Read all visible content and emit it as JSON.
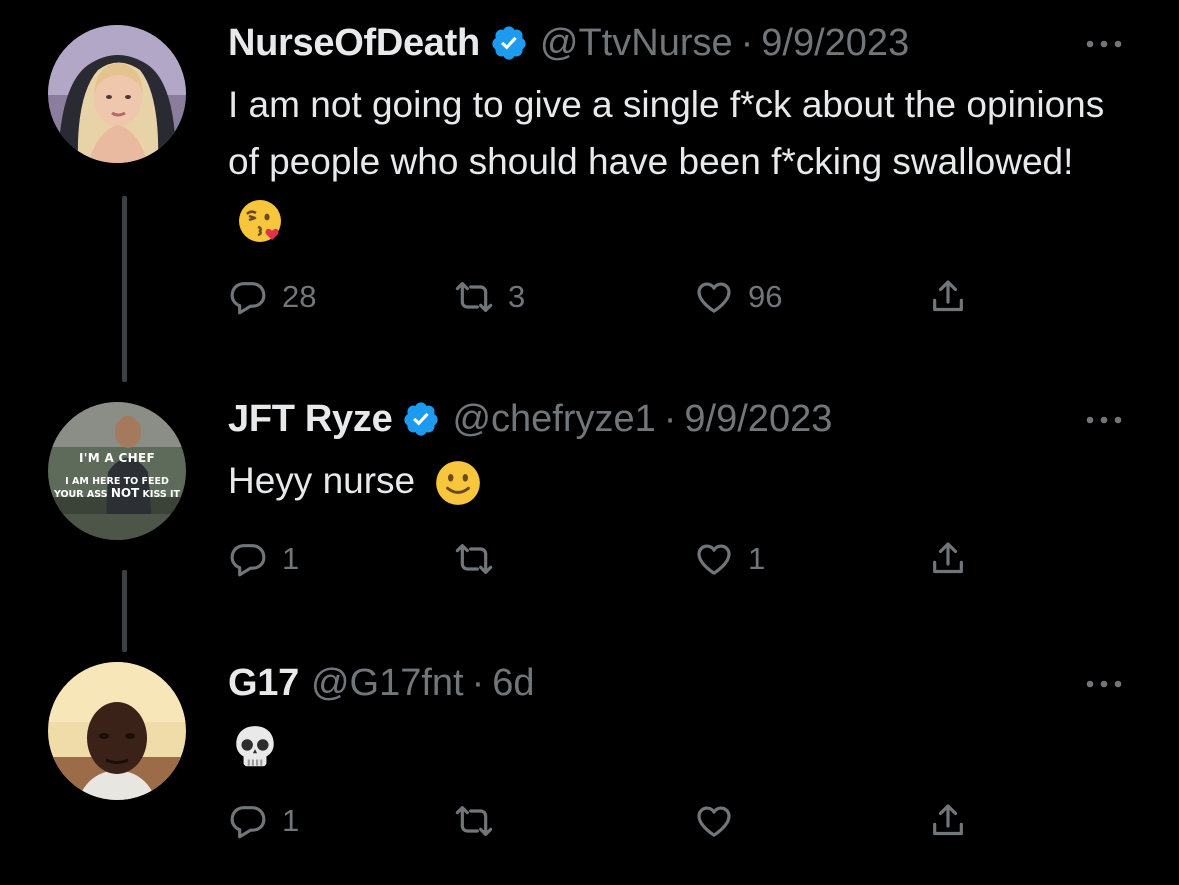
{
  "tweets": [
    {
      "name": "NurseOfDeath",
      "verified": true,
      "handle": "@TtvNurse",
      "sep": "·",
      "date": "9/9/2023",
      "text": "I am not going to give a single f*ck about the opinions of people who should have been f*cking swallowed!",
      "emoji": "kissing-face-with-heart-emoji",
      "replies": "28",
      "retweets": "3",
      "likes": "96"
    },
    {
      "name": "JFT Ryze",
      "verified": true,
      "handle": "@chefryze1",
      "sep": "·",
      "date": "9/9/2023",
      "text": "Heyy nurse",
      "emoji": "slightly-smiling-face-emoji",
      "avatar_text": {
        "line1": "I'M A CHEF",
        "line2": "I AM HERE TO FEED",
        "line3a": "YOUR ASS ",
        "line3b": "NOT",
        "line3c": " KISS IT"
      },
      "replies": "1",
      "retweets": "",
      "likes": "1"
    },
    {
      "name": "G17",
      "verified": false,
      "handle": "@G17fnt",
      "sep": "·",
      "date": "6d",
      "text": "",
      "emoji": "skull-emoji",
      "replies": "1",
      "retweets": "",
      "likes": ""
    }
  ],
  "colors": {
    "background": "#000000",
    "primary_text": "#e7e9ea",
    "secondary_text": "#71767b",
    "verified_badge": "#1d9bf0",
    "thread_line": "#3b4045"
  }
}
